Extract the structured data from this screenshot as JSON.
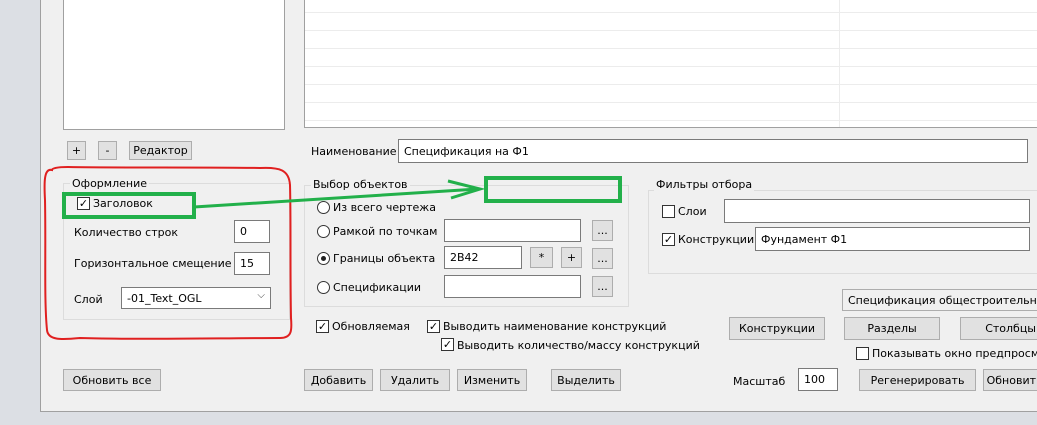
{
  "left_panel": {
    "add_label": "+",
    "remove_label": "-",
    "editor_label": "Редактор"
  },
  "design_group": {
    "title": "Оформление",
    "header_checkbox": "Заголовок",
    "header_checked": true,
    "rows_label": "Количество строк",
    "rows_value": "0",
    "hoffset_label": "Горизонтальное смещение",
    "hoffset_value": "15",
    "layer_label": "Слой",
    "layer_value": "-01_Text_OGL"
  },
  "name_field": {
    "label": "Наименование",
    "value": "Спецификация на Ф1"
  },
  "selection_group": {
    "title": "Выбор объектов",
    "opt_whole": "Из всего чертежа",
    "opt_frame": "Рамкой по точкам",
    "opt_bounds": "Границы объекта",
    "opt_spec": "Спецификации",
    "bounds_value": "2B42",
    "ellipsis": "...",
    "star": "*",
    "plus": "+",
    "selected": "opt_bounds"
  },
  "filters_group": {
    "title": "Фильтры отбора",
    "layers_label": "Слои",
    "layers_checked": false,
    "layers_value": "",
    "constructions_label": "Конструкции",
    "constructions_checked": true,
    "constructions_value": "Фундамент Ф1"
  },
  "spec_dropdown": "Спецификация общестроительная",
  "checkboxes": {
    "updatable": "Обновляемая",
    "show_name": "Выводить наименование конструкций",
    "show_qty": "Выводить количество/массу конструкций",
    "show_preview": "Показывать окно предпросмот"
  },
  "buttons": {
    "update_all": "Обновить все",
    "add": "Добавить",
    "delete": "Удалить",
    "edit": "Изменить",
    "select": "Выделить",
    "constructions": "Конструкции",
    "sections": "Разделы",
    "columns": "Столбцы",
    "regenerate": "Регенерировать",
    "update": "Обновит"
  },
  "scale": {
    "label": "Масштаб",
    "value": "100"
  },
  "annotation_colors": {
    "red": "#e02020",
    "green": "#22b04a"
  }
}
